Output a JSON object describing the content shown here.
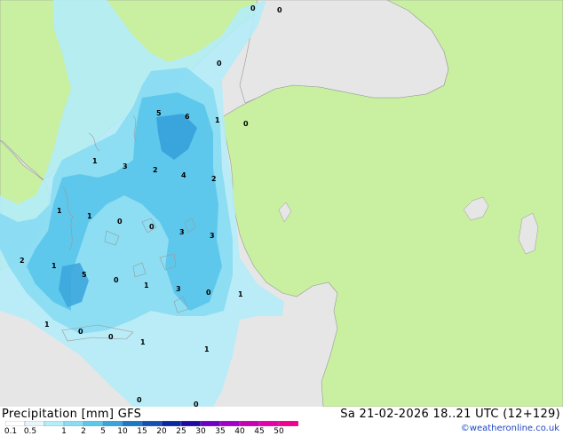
{
  "map": {
    "land_label_values": [
      {
        "text": "0",
        "cx": 1,
        "cy": 1
      }
    ],
    "values": [
      {
        "text": "0"
      },
      {
        "text": "0"
      },
      {
        "text": "0"
      },
      {
        "text": "5"
      },
      {
        "text": "6"
      },
      {
        "text": "1"
      },
      {
        "text": "0"
      },
      {
        "text": "1"
      },
      {
        "text": "3"
      },
      {
        "text": "2"
      },
      {
        "text": "4"
      },
      {
        "text": "2"
      },
      {
        "text": "1"
      },
      {
        "text": "1"
      },
      {
        "text": "0"
      },
      {
        "text": "0"
      },
      {
        "text": "3"
      },
      {
        "text": "3"
      },
      {
        "text": "2"
      },
      {
        "text": "1"
      },
      {
        "text": "5"
      },
      {
        "text": "0"
      },
      {
        "text": "1"
      },
      {
        "text": "3"
      },
      {
        "text": "0"
      },
      {
        "text": "1"
      },
      {
        "text": "1"
      },
      {
        "text": "0"
      },
      {
        "text": "0"
      },
      {
        "text": "1"
      },
      {
        "text": "1"
      },
      {
        "text": "0"
      },
      {
        "text": "0"
      }
    ]
  },
  "footer": {
    "title": "Precipitation [mm] GFS",
    "datetime": "Sa 21-02-2026 18..21 UTC (12+129)",
    "credit": "©weatheronline.co.uk"
  },
  "legend": {
    "ticks": [
      "0.1",
      "0.5",
      "1",
      "2",
      "5",
      "10",
      "15",
      "20",
      "25",
      "30",
      "35",
      "40",
      "45",
      "50"
    ],
    "colors": [
      "#ffffff",
      "#e6f6fb",
      "#b4ecf8",
      "#8adcf2",
      "#5ec8ec",
      "#3aa5dc",
      "#1e78c8",
      "#1450b4",
      "#0a28a0",
      "#1e0aa0",
      "#6e00c8",
      "#a000c8",
      "#c800b4",
      "#e600aa",
      "#f0008c"
    ]
  },
  "colors": {
    "sea": "#e6e6e6",
    "land": "#c8f0a0",
    "precip_light": "#b4ecf8",
    "precip_mid": "#8adcf2",
    "precip_heavy": "#5ec8ec",
    "precip_heavier": "#3aa5dc",
    "border": "#999999",
    "credit": "#1e46c8"
  }
}
